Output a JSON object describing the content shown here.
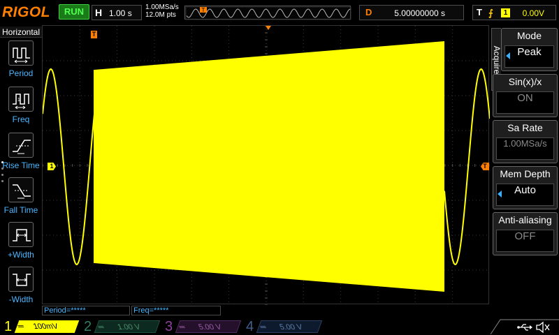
{
  "header": {
    "logo": "RIGOL",
    "run_status": "RUN",
    "horizontal_label": "H",
    "timebase": "1.00 s",
    "sample_rate": "1.00MSa/s",
    "memory_points": "12.0M pts",
    "trigger_marker": "T",
    "delay_label": "D",
    "delay_value": "5.00000000 s",
    "trigger_label": "T",
    "trigger_edge": "⨍",
    "trigger_source": "1",
    "trigger_level": "0.00V"
  },
  "left_panel": {
    "title": "Horizontal",
    "items": [
      {
        "label": "Period"
      },
      {
        "label": "Freq"
      },
      {
        "label": "Rise Time"
      },
      {
        "label": "Fall Time"
      },
      {
        "label": "+Width"
      },
      {
        "label": "-Width"
      }
    ]
  },
  "markers": {
    "ch1": "1",
    "trigger_top": "T",
    "trigger_right": "T"
  },
  "menu": {
    "tab": "Acquire",
    "items": [
      {
        "title": "Mode",
        "value": "Peak",
        "enabled": true
      },
      {
        "title": "Sin(x)/x",
        "value": "ON",
        "enabled": false
      },
      {
        "title": "Sa Rate",
        "value": "1.00MSa/s",
        "enabled": false
      },
      {
        "title": "Mem Depth",
        "value": "Auto",
        "enabled": true
      },
      {
        "title": "Anti-aliasing",
        "value": "OFF",
        "enabled": false
      }
    ]
  },
  "measurements": {
    "period": "Period=*****",
    "freq": "Freq=*****"
  },
  "channels": [
    {
      "num": "1",
      "coupling": "═",
      "scale": "100mV",
      "color": "#ffff00"
    },
    {
      "num": "2",
      "coupling": "═",
      "scale": "1.00 V",
      "color": "#2f7f5f"
    },
    {
      "num": "3",
      "coupling": "═",
      "scale": "5.00 V",
      "color": "#8f3f9f"
    },
    {
      "num": "4",
      "coupling": "═",
      "scale": "5.00 V",
      "color": "#3f5f8f"
    }
  ],
  "colors": {
    "trace": "#ffff00",
    "accent": "#ff8000",
    "measure_text": "#4ab6ff",
    "run_green": "#50ff50"
  },
  "status_icons": [
    "usb-icon",
    "speaker-muted-icon"
  ]
}
